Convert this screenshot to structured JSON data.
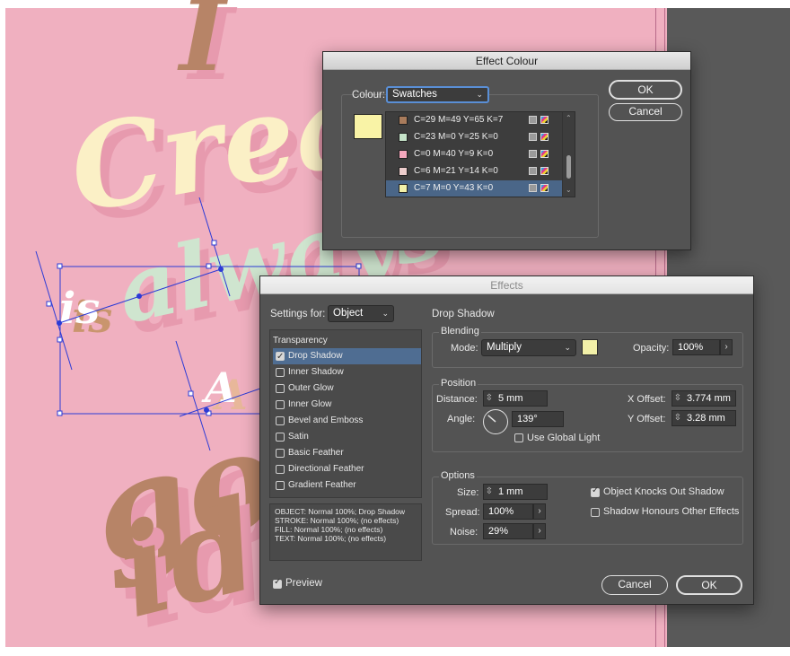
{
  "canvas": {
    "artboard_color": "#f0b0c0",
    "pasteboard_color": "#595959",
    "art_words": [
      "I",
      "Cream",
      "is",
      "always",
      "A",
      "good",
      "idea"
    ]
  },
  "effect_colour_dialog": {
    "title": "Effect Colour",
    "colour_label": "Colour:",
    "colour_value": "Swatches",
    "selected_swatch_color": "#f9f3a6",
    "swatches": [
      {
        "label": "C=29 M=49 Y=65 K=7",
        "color": "#a97c5c",
        "selected": false
      },
      {
        "label": "C=23 M=0 Y=25 K=0",
        "color": "#c5e3c9",
        "selected": false
      },
      {
        "label": "C=0 M=40 Y=9 K=0",
        "color": "#f4a7bd",
        "selected": false
      },
      {
        "label": "C=6 M=21 Y=14 K=0",
        "color": "#eccdcc",
        "selected": false
      },
      {
        "label": "C=7 M=0 Y=43 K=0",
        "color": "#f2f0a8",
        "selected": true
      }
    ],
    "ok_label": "OK",
    "cancel_label": "Cancel"
  },
  "effects_dialog": {
    "title": "Effects",
    "settings_for_label": "Settings for:",
    "settings_for_value": "Object",
    "section_title": "Drop Shadow",
    "transparency_label": "Transparency",
    "effects": [
      {
        "label": "Drop Shadow",
        "checked": true,
        "selected": true
      },
      {
        "label": "Inner Shadow",
        "checked": false,
        "selected": false
      },
      {
        "label": "Outer Glow",
        "checked": false,
        "selected": false
      },
      {
        "label": "Inner Glow",
        "checked": false,
        "selected": false
      },
      {
        "label": "Bevel and Emboss",
        "checked": false,
        "selected": false
      },
      {
        "label": "Satin",
        "checked": false,
        "selected": false
      },
      {
        "label": "Basic Feather",
        "checked": false,
        "selected": false
      },
      {
        "label": "Directional Feather",
        "checked": false,
        "selected": false
      },
      {
        "label": "Gradient Feather",
        "checked": false,
        "selected": false
      }
    ],
    "summary": [
      "OBJECT: Normal 100%; Drop Shadow",
      "STROKE: Normal 100%; (no effects)",
      "FILL: Normal 100%; (no effects)",
      "TEXT: Normal 100%; (no effects)"
    ],
    "blending": {
      "title": "Blending",
      "mode_label": "Mode:",
      "mode_value": "Multiply",
      "swatch_color": "#f2f0a8",
      "opacity_label": "Opacity:",
      "opacity_value": "100%"
    },
    "position": {
      "title": "Position",
      "distance_label": "Distance:",
      "distance_value": "5 mm",
      "angle_label": "Angle:",
      "angle_value": "139°",
      "angle_degrees": 139,
      "use_global_light_label": "Use Global Light",
      "use_global_light": false,
      "x_offset_label": "X Offset:",
      "x_offset_value": "3.774 mm",
      "y_offset_label": "Y Offset:",
      "y_offset_value": "3.28 mm"
    },
    "options": {
      "title": "Options",
      "size_label": "Size:",
      "size_value": "1 mm",
      "spread_label": "Spread:",
      "spread_value": "100%",
      "noise_label": "Noise:",
      "noise_value": "29%",
      "knocks_out_label": "Object Knocks Out Shadow",
      "knocks_out": true,
      "honours_label": "Shadow Honours Other Effects",
      "honours": false
    },
    "preview_label": "Preview",
    "preview": true,
    "cancel_label": "Cancel",
    "ok_label": "OK"
  }
}
